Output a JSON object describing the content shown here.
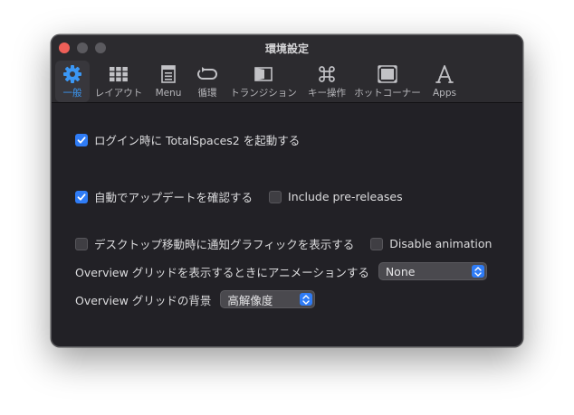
{
  "window": {
    "title": "環境設定"
  },
  "toolbar": {
    "items": [
      {
        "label": "一般",
        "icon": "gear-icon",
        "active": true
      },
      {
        "label": "レイアウト",
        "icon": "grid-icon",
        "active": false
      },
      {
        "label": "Menu",
        "icon": "menu-icon",
        "active": false
      },
      {
        "label": "循環",
        "icon": "cycle-icon",
        "active": false
      },
      {
        "label": "トランジション",
        "icon": "transition-icon",
        "active": false
      },
      {
        "label": "キー操作",
        "icon": "command-key-icon",
        "active": false
      },
      {
        "label": "ホットコーナー",
        "icon": "hot-corner-icon",
        "active": false
      },
      {
        "label": "Apps",
        "icon": "apps-icon",
        "active": false
      }
    ]
  },
  "settings": {
    "launch_at_login": {
      "label": "ログイン時に TotalSpaces2 を起動する",
      "checked": true
    },
    "auto_update": {
      "label": "自動でアップデートを確認する",
      "checked": true
    },
    "include_prereleases": {
      "label": "Include pre-releases",
      "checked": false
    },
    "desktop_notify": {
      "label": "デスクトップ移動時に通知グラフィックを表示する",
      "checked": false
    },
    "disable_animation": {
      "label": "Disable animation",
      "checked": false
    },
    "overview_animation": {
      "label": "Overview グリッドを表示するときにアニメーションする",
      "value": "None"
    },
    "overview_background": {
      "label": "Overview グリッドの背景",
      "value": "高解像度"
    }
  },
  "colors": {
    "accent": "#2f7cf6",
    "active_label": "#3b97f4",
    "window_bg": "#222126"
  }
}
